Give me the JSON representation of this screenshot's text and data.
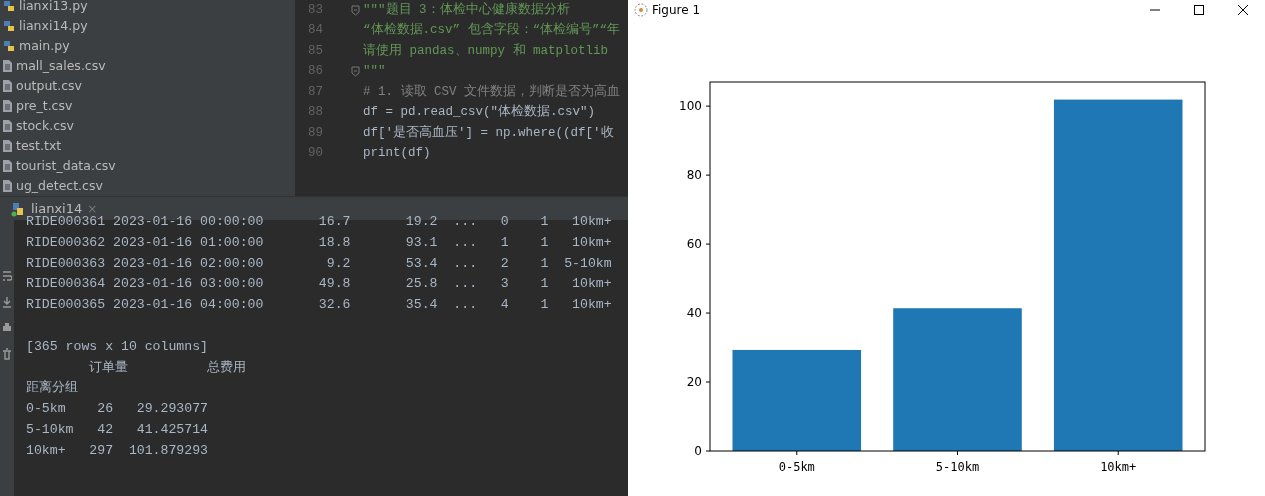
{
  "project_files": [
    {
      "name": "lianxi13.py",
      "kind": "python"
    },
    {
      "name": "lianxi14.py",
      "kind": "python"
    },
    {
      "name": "main.py",
      "kind": "python"
    },
    {
      "name": "mall_sales.csv",
      "kind": "file"
    },
    {
      "name": "output.csv",
      "kind": "file"
    },
    {
      "name": "pre_t.csv",
      "kind": "file"
    },
    {
      "name": "stock.csv",
      "kind": "file"
    },
    {
      "name": "test.txt",
      "kind": "file"
    },
    {
      "name": "tourist_data.csv",
      "kind": "file"
    },
    {
      "name": "ug_detect.csv",
      "kind": "file"
    }
  ],
  "editor": {
    "lines": [
      {
        "number": "83",
        "text": "\"\"\"题目 3：体检中心健康数据分析",
        "kind": "docstring",
        "fold": true
      },
      {
        "number": "84",
        "text": "“体检数据.csv” 包含字段：“体检编号”“年",
        "kind": "docstring",
        "fold": false
      },
      {
        "number": "85",
        "text": "请使用 pandas、numpy 和 matplotlib",
        "kind": "docstring",
        "fold": false
      },
      {
        "number": "86",
        "text": "\"\"\"",
        "kind": "docstring",
        "fold": true
      },
      {
        "number": "87",
        "text": "# 1. 读取 CSV 文件数据，判断是否为高血",
        "kind": "comment",
        "fold": false
      },
      {
        "number": "88",
        "text": "df = pd.read_csv(\"体检数据.csv\")",
        "kind": "code",
        "fold": false
      },
      {
        "number": "89",
        "text": "df['是否高血压'] = np.where((df['收",
        "kind": "code",
        "fold": false
      },
      {
        "number": "90",
        "text": "print(df)",
        "kind": "code",
        "fold": false
      }
    ]
  },
  "run_tab": {
    "label": "lianxi14",
    "close_label": "×"
  },
  "console": {
    "table_rows": [
      "RIDE000361 2023-01-16 00:00:00       16.7       19.2  ...   0    1   10km+",
      "RIDE000362 2023-01-16 01:00:00       18.8       93.1  ...   1    1   10km+",
      "RIDE000363 2023-01-16 02:00:00        9.2       53.4  ...   2    1  5-10km",
      "RIDE000364 2023-01-16 03:00:00       49.8       25.8  ...   3    1   10km+",
      "RIDE000365 2023-01-16 04:00:00       32.6       35.4  ...   4    1   10km+"
    ],
    "summary_lines": [
      "[365 rows x 10 columns]",
      "        订单量          总费用",
      "距离分组",
      "0-5km    26   29.293077",
      "5-10km   42   41.425714",
      "10km+   297  101.879293"
    ]
  },
  "figure": {
    "title": "Figure 1",
    "chart_data": {
      "type": "bar",
      "categories": [
        "0-5km",
        "5-10km",
        "10km+"
      ],
      "values": [
        29.3,
        41.4,
        101.9
      ],
      "ylim": [
        0,
        107
      ],
      "yticks": [
        0,
        20,
        40,
        60,
        80,
        100
      ]
    }
  }
}
